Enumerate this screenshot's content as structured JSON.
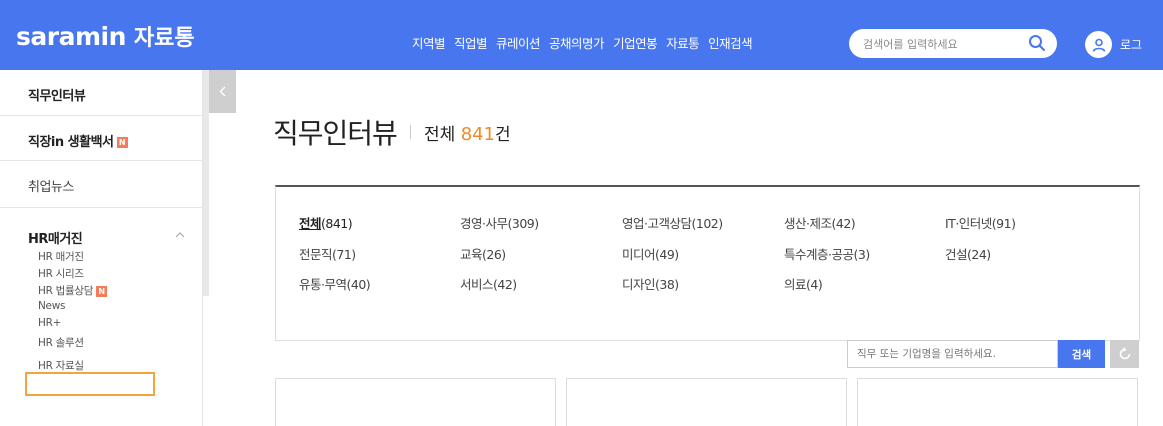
{
  "header": {
    "logo_en": "saramin",
    "logo_ko": "자료통",
    "nav": [
      "지역별",
      "직업별",
      "큐레이션",
      "공채의명가",
      "기업연봉",
      "자료통",
      "인재검색"
    ],
    "search_placeholder": "검색어를 입력하세요",
    "login_label": "로그"
  },
  "sidebar": {
    "items": [
      {
        "label": "직무인터뷰"
      },
      {
        "label": "직장in 생활백서",
        "badge": "N"
      },
      {
        "label": "취업뉴스"
      },
      {
        "label": "HR매거진",
        "expanded": true
      }
    ],
    "sub_items": [
      {
        "label": "HR 매거진"
      },
      {
        "label": "HR 시리즈"
      },
      {
        "label": "HR 법률상담",
        "badge": "N"
      },
      {
        "label": "News"
      },
      {
        "label": "HR+"
      },
      {
        "label": "HR 솔루션"
      },
      {
        "label": "HR 자료실",
        "highlighted": true
      }
    ]
  },
  "main": {
    "title": "직무인터뷰",
    "total_prefix": "전체",
    "total_count": "841",
    "total_suffix": "건",
    "categories": [
      {
        "name": "전체",
        "count": "(841)",
        "active": true
      },
      {
        "name": "경영·사무",
        "count": "(309)"
      },
      {
        "name": "영업·고객상담",
        "count": "(102)"
      },
      {
        "name": "생산·제조",
        "count": "(42)"
      },
      {
        "name": "IT·인터넷",
        "count": "(91)"
      },
      {
        "name": "전문직",
        "count": "(71)"
      },
      {
        "name": "교육",
        "count": "(26)"
      },
      {
        "name": "미디어",
        "count": "(49)"
      },
      {
        "name": "특수계층·공공",
        "count": "(3)"
      },
      {
        "name": "건설",
        "count": "(24)"
      },
      {
        "name": "유통·무역",
        "count": "(40)"
      },
      {
        "name": "서비스",
        "count": "(42)"
      },
      {
        "name": "디자인",
        "count": "(38)"
      },
      {
        "name": "의료",
        "count": "(4)"
      }
    ],
    "search_placeholder": "직무 또는 기업명을 입력하세요.",
    "search_button": "검색"
  },
  "colors": {
    "brand_blue": "#4876ef",
    "accent_orange": "#f08a24",
    "badge_red": "#f47c5a",
    "highlight_border": "#f5a340"
  }
}
